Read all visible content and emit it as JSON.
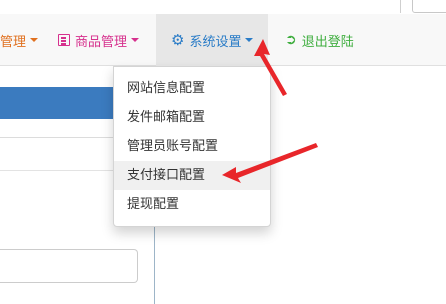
{
  "navbar": {
    "items": [
      {
        "label": "管理",
        "icon": null,
        "color": "#e0701f",
        "has_caret": true
      },
      {
        "label": "商品管理",
        "icon": "list-icon",
        "color": "#d6308d",
        "has_caret": true
      },
      {
        "label": "系统设置",
        "icon": "gear-icon",
        "color": "#2a7cc7",
        "has_caret": true,
        "active": true
      },
      {
        "label": "退出登陆",
        "icon": "logout-icon",
        "color": "#3fae3f",
        "has_caret": false
      }
    ]
  },
  "settings_menu": {
    "items": [
      {
        "label": "网站信息配置"
      },
      {
        "label": "发件邮箱配置"
      },
      {
        "label": "管理员账号配置"
      },
      {
        "label": "支付接口配置",
        "highlighted": true
      },
      {
        "label": "提现配置"
      }
    ]
  },
  "colors": {
    "panel_header": "#3b7bbf",
    "annotation_arrow": "#e8262a",
    "navbar_bg": "#f8f8f8"
  }
}
